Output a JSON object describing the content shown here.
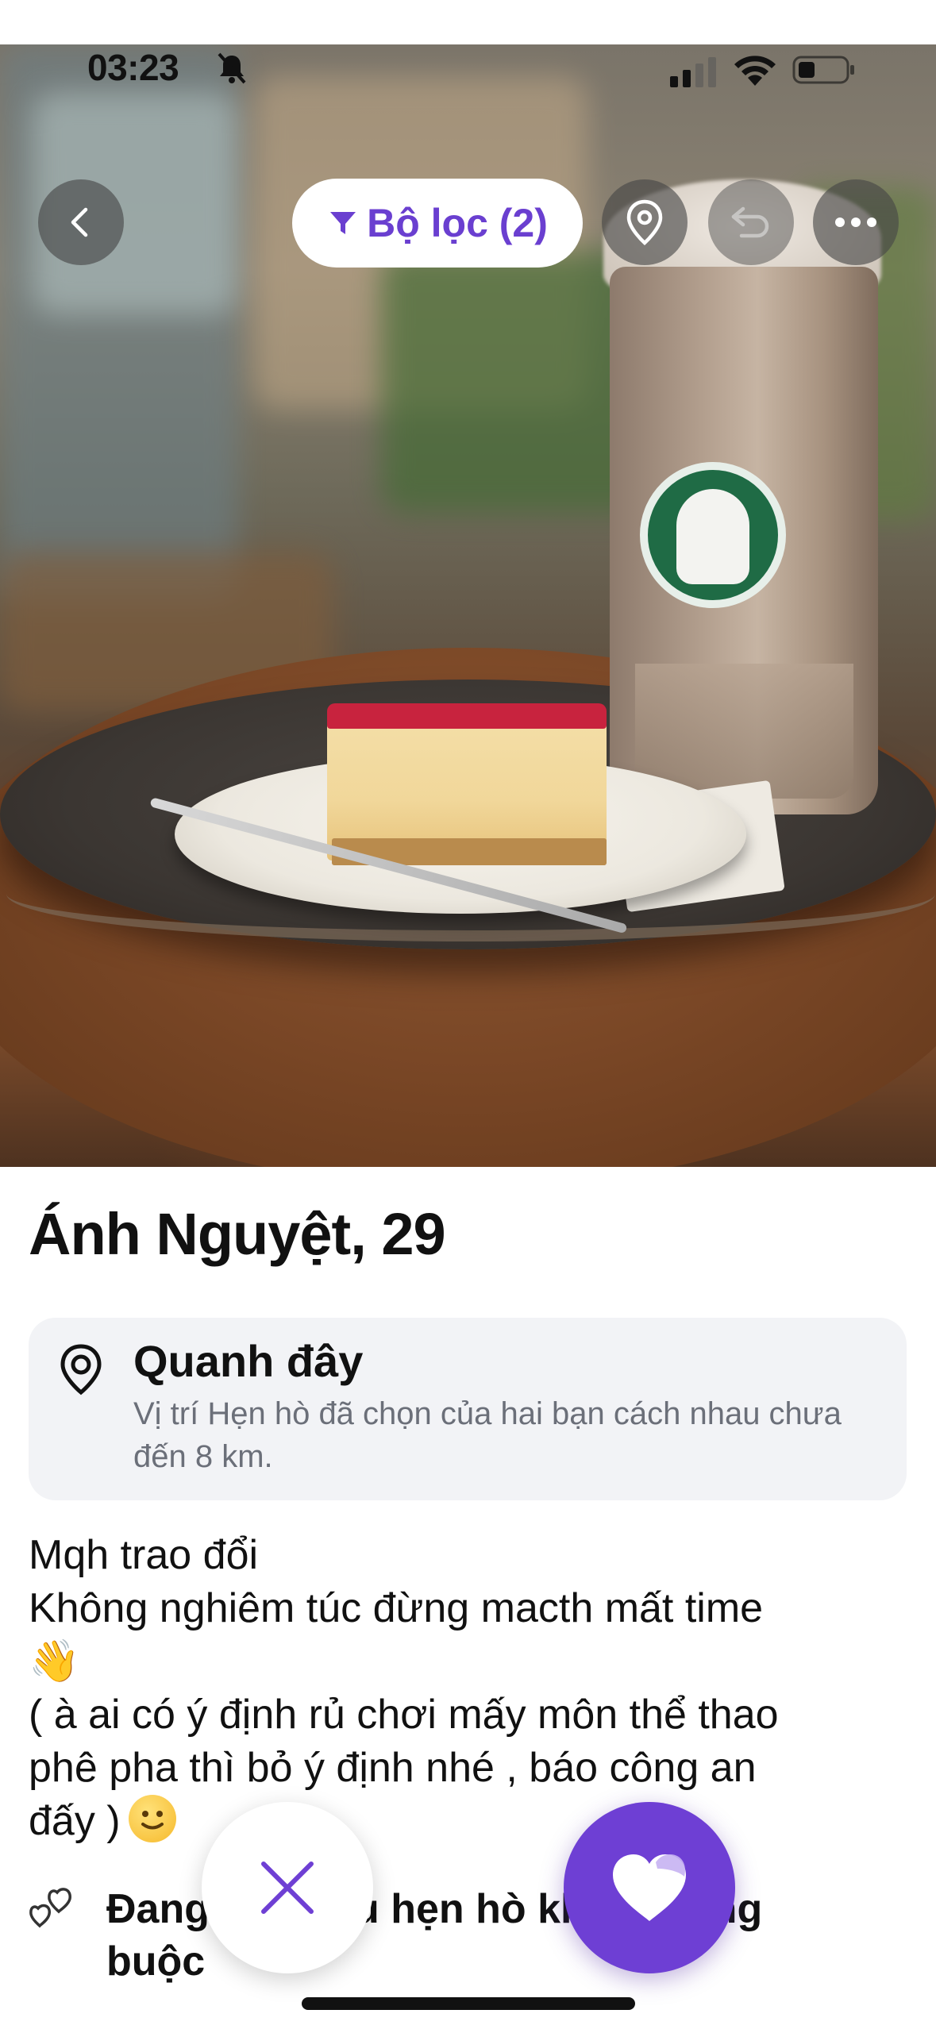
{
  "status_bar": {
    "time": "03:23"
  },
  "header": {
    "filter_label": "Bộ lọc (2)"
  },
  "icons": {
    "back": "chevron-left-icon",
    "filter": "filter-icon",
    "location": "map-pin-icon",
    "undo": "undo-icon",
    "more": "more-dots-icon",
    "pass": "close-icon",
    "like": "heart-icon"
  },
  "profile": {
    "name_age": "Ánh Nguyệt, 29",
    "location_title": "Quanh đây",
    "location_desc": "Vị trí Hẹn hò đã chọn của hai bạn cách nhau chưa đến 8 km.",
    "bio_line1": "Mqh trao đổi",
    "bio_line2": "Không nghiêm túc đừng macth mất time",
    "bio_emoji_wave": "👋",
    "bio_line3": "( à ai có ý định rủ chơi mấy môn thể thao",
    "bio_line4": "phê pha thì bỏ ý định nhé , báo công an",
    "bio_line5": "đấy )",
    "intent": "Đang tìm hiểu hẹn hò không ràng buộc"
  },
  "colors": {
    "accent": "#6e3fd4",
    "filter_text": "#6a3fd0",
    "card_bg": "#f2f3f6",
    "muted_text": "#6b6f79"
  }
}
